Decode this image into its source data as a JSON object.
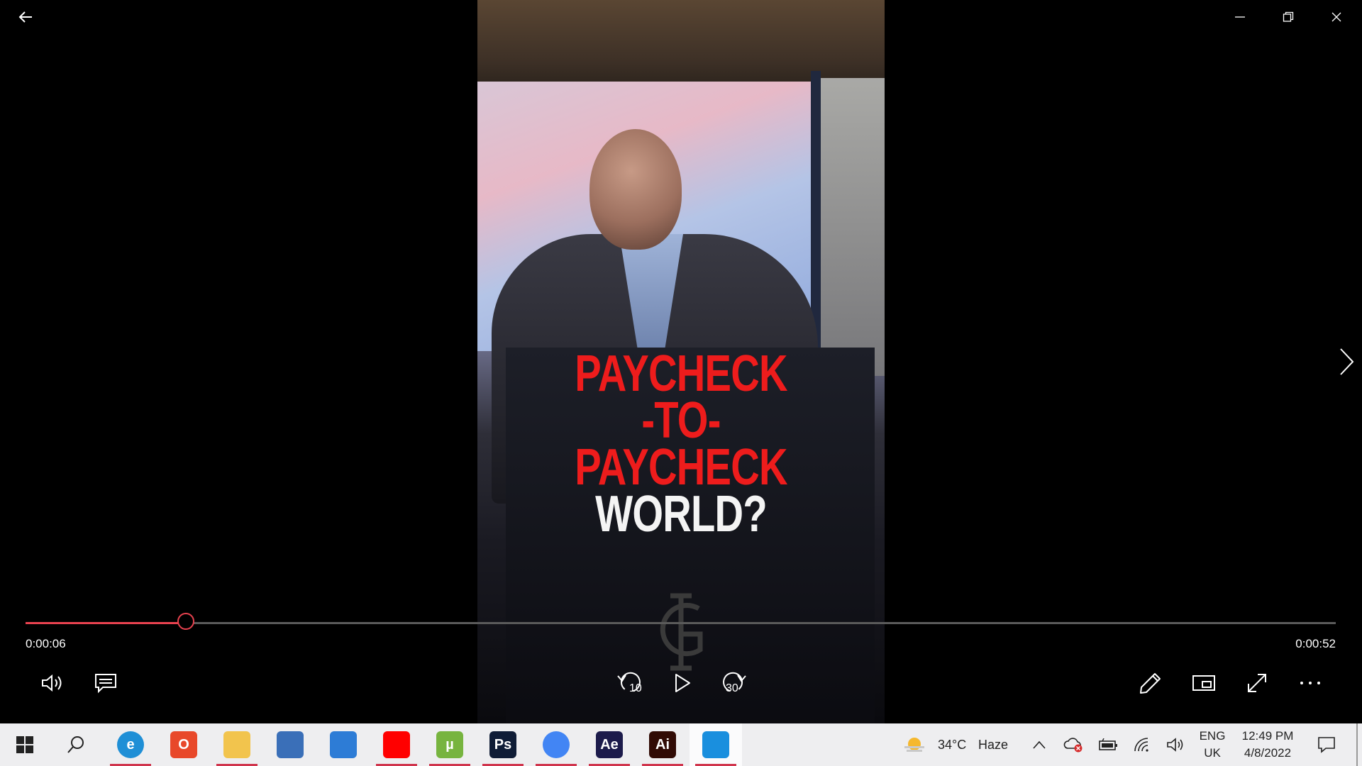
{
  "video": {
    "overlay_lines": [
      {
        "text": "PAYCHECK",
        "color": "#ee1c1c"
      },
      {
        "text": "-TO-",
        "color": "#ee1c1c"
      },
      {
        "text": "PAYCHECK",
        "color": "#ee1c1c"
      },
      {
        "text": "WORLD?",
        "color": "#f4f4f4"
      }
    ],
    "logo_icon": "monogram-gh-logo"
  },
  "player": {
    "current_time": "0:00:06",
    "duration": "0:00:52",
    "progress_fraction": 0.1234,
    "accent_color": "#e8424f",
    "skip_back_label": "10",
    "skip_forward_label": "30"
  },
  "window_controls": {
    "back_icon": "back-arrow-icon",
    "minimize_icon": "minimize-icon",
    "restore_icon": "restore-icon",
    "close_icon": "close-icon",
    "next_icon": "chevron-right-icon"
  },
  "taskbar": {
    "apps": [
      {
        "name": "edge",
        "label": "e",
        "color": "#1f8fd6",
        "running": true
      },
      {
        "name": "office",
        "label": "O",
        "color": "#e8482a",
        "running": false
      },
      {
        "name": "file-explorer",
        "label": "",
        "color": "#f2c44d",
        "running": true
      },
      {
        "name": "microsoft-store",
        "label": "",
        "color": "#3a6fb8",
        "running": false
      },
      {
        "name": "mail",
        "label": "",
        "color": "#2d7cd6",
        "running": false
      },
      {
        "name": "youtube",
        "label": "",
        "color": "#ff0000",
        "running": true
      },
      {
        "name": "utorrent",
        "label": "µ",
        "color": "#77b43f",
        "running": true
      },
      {
        "name": "photoshop",
        "label": "Ps",
        "color": "#0f1c36",
        "running": true
      },
      {
        "name": "chrome",
        "label": "",
        "color": "#4285f4",
        "running": true
      },
      {
        "name": "after-effects",
        "label": "Ae",
        "color": "#1c1b4b",
        "running": true
      },
      {
        "name": "illustrator",
        "label": "Ai",
        "color": "#310b05",
        "running": true
      },
      {
        "name": "movies-and-tv",
        "label": "",
        "color": "#1a8fde",
        "running": true
      }
    ],
    "weather": {
      "temp": "34°C",
      "condition": "Haze"
    },
    "language": {
      "line1": "ENG",
      "line2": "UK"
    },
    "clock": {
      "time": "12:49 PM",
      "date": "4/8/2022"
    }
  }
}
